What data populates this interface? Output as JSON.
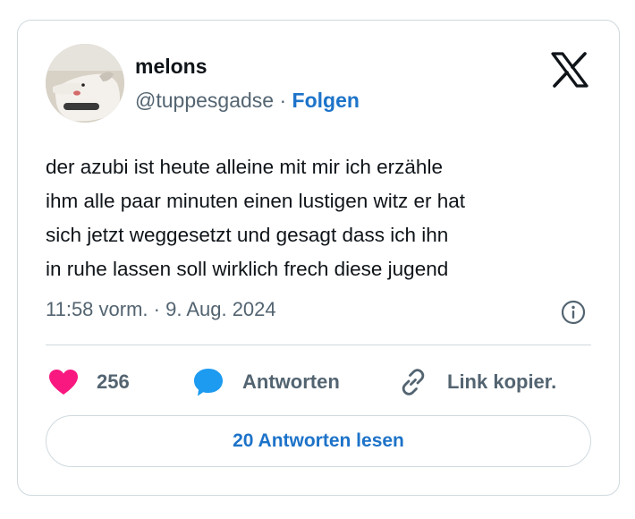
{
  "tweet": {
    "author": {
      "name": "melons",
      "handle": "@tuppesgadse",
      "separator": "·",
      "follow_label": "Folgen"
    },
    "text_lines": [
      "der azubi ist heute alleine mit mir ich erzähle",
      "ihm alle paar minuten einen lustigen witz er hat",
      "sich jetzt weggesetzt und gesagt dass ich ihn",
      "in ruhe lassen soll wirklich frech diese jugend"
    ],
    "timestamp": "11:58 vorm. · 9. Aug. 2024",
    "actions": {
      "like_count": "256",
      "reply_label": "Antworten",
      "copy_label": "Link kopier."
    },
    "read_replies_label": "20 Antworten lesen"
  },
  "colors": {
    "like": "#f91880",
    "reply": "#1d9bf0",
    "link": "#1d73c9",
    "muted": "#536471",
    "border": "#cfd9de"
  },
  "icons": [
    "x-logo-icon",
    "info-icon",
    "heart-icon",
    "speech-bubble-icon",
    "link-icon"
  ]
}
